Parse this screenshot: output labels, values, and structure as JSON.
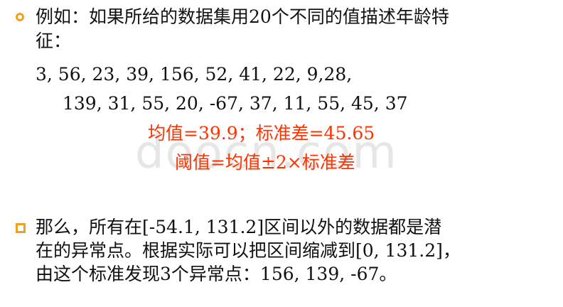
{
  "watermark": "doocn.com",
  "bullet1": {
    "line1": "例如：如果所给的数据集用20个不同的值描述年龄特",
    "line2": "征：",
    "data_line1": "3,  56,  23,  39,  156,  52,  41,  22,  9,28,",
    "data_line2": "139,  31,  55,  20,  -67,  37,  11,  55,  45,  37"
  },
  "highlight": {
    "line1": "均值=39.9；标准差=45.65",
    "line2": "阈值=均值±2×标准差"
  },
  "bullet2": {
    "line1": "那么，所有在[-54.1,  131.2]区间以外的数据都是潜",
    "line2": "在的异常点。根据实际可以把区间缩减到[0,  131.2]，",
    "line3": "由这个标准发现3个异常点：156,  139,  -67。"
  },
  "colors": {
    "accent_bullet": "#f0a020",
    "highlight_text": "#ff3300"
  }
}
